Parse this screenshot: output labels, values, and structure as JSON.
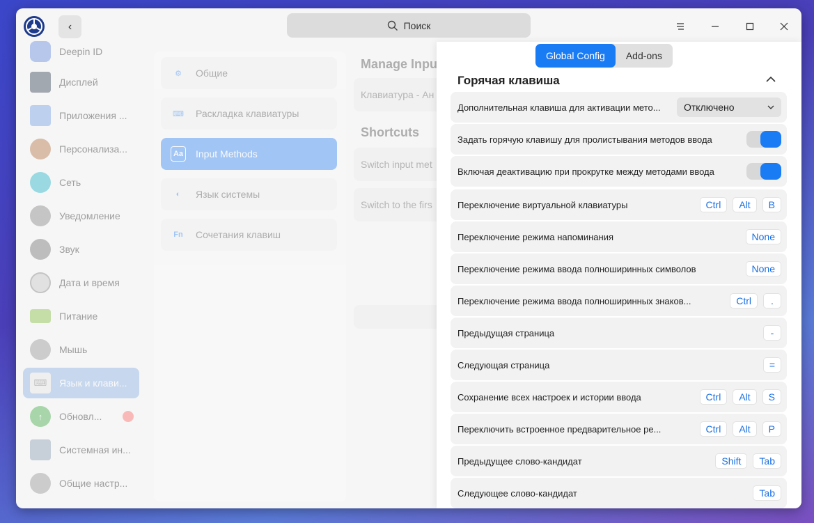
{
  "search": {
    "label": "Поиск"
  },
  "sidebar": {
    "items": [
      {
        "label": "Deepin ID",
        "icon": "deepin-id-icon",
        "color": "#6a8ee0"
      },
      {
        "label": "Дисплей",
        "icon": "display-icon",
        "color": "#3c4a5a"
      },
      {
        "label": "Приложения ...",
        "icon": "apps-icon",
        "color": "#7aa6e8"
      },
      {
        "label": "Персонализа...",
        "icon": "palette-icon",
        "color": "#b87a4a"
      },
      {
        "label": "Сеть",
        "icon": "network-icon",
        "color": "#2bb6c8"
      },
      {
        "label": "Уведомление",
        "icon": "bell-icon",
        "color": "#8a8a8a"
      },
      {
        "label": "Звук",
        "icon": "speaker-icon",
        "color": "#7a7a7a"
      },
      {
        "label": "Дата и время",
        "icon": "clock-icon",
        "color": "#c8c8c8"
      },
      {
        "label": "Питание",
        "icon": "battery-icon",
        "color": "#8bc34a"
      },
      {
        "label": "Мышь",
        "icon": "mouse-icon",
        "color": "#9a9a9a"
      },
      {
        "label": "Язык и клави...",
        "icon": "keyboard-icon",
        "color": "#e8e8e8"
      },
      {
        "label": "Обновл...",
        "icon": "update-icon",
        "color": "#4caf50"
      },
      {
        "label": "Системная ин...",
        "icon": "system-info-icon",
        "color": "#90a4b8"
      },
      {
        "label": "Общие настр...",
        "icon": "general-settings-icon",
        "color": "#9a9a9a"
      }
    ]
  },
  "middle": {
    "items": [
      {
        "label": "Общие",
        "icon": "gear-icon",
        "glyph": "⚙"
      },
      {
        "label": "Раскладка клавиатуры",
        "icon": "keyboard-layout-icon",
        "glyph": "⌨"
      },
      {
        "label": "Input Methods",
        "icon": "input-methods-icon",
        "glyph": "Aa"
      },
      {
        "label": "Язык системы",
        "icon": "globe-icon",
        "glyph": "◐"
      },
      {
        "label": "Сочетания клавиш",
        "icon": "fn-icon",
        "glyph": "Fn"
      }
    ]
  },
  "right_bg": {
    "manage_title": "Manage Inpu",
    "keyboard_row": "Клавиатура - Ан",
    "shortcuts_title": "Shortcuts",
    "switch_input": "Switch input met",
    "switch_first": "Switch to the firs"
  },
  "panel": {
    "tabs": [
      "Global Config",
      "Add-ons"
    ],
    "section_title": "Горячая клавиша",
    "dropdown": {
      "label": "Дополнительная клавиша для активации мето...",
      "value": "Отключено"
    },
    "toggles": [
      {
        "label": "Задать горячую клавишу для пролистывания методов ввода",
        "on": true
      },
      {
        "label": "Включая деактивацию при прокрутке между методами ввода",
        "on": true
      }
    ],
    "shortcuts": [
      {
        "label": "Переключение виртуальной клавиатуры",
        "keys": [
          "Ctrl",
          "Alt",
          "B"
        ]
      },
      {
        "label": "Переключение режима напоминания",
        "keys": [
          "None"
        ]
      },
      {
        "label": "Переключение режима ввода полноширинных символов",
        "keys": [
          "None"
        ]
      },
      {
        "label": "Переключение режима ввода полноширинных знаков...",
        "keys": [
          "Ctrl",
          "."
        ]
      },
      {
        "label": "Предыдущая страница",
        "keys": [
          "-"
        ]
      },
      {
        "label": "Следующая страница",
        "keys": [
          "="
        ]
      },
      {
        "label": "Сохранение всех настроек и истории ввода",
        "keys": [
          "Ctrl",
          "Alt",
          "S"
        ]
      },
      {
        "label": "Переключить встроенное предварительное ре...",
        "keys": [
          "Ctrl",
          "Alt",
          "P"
        ]
      },
      {
        "label": "Предыдущее слово-кандидат",
        "keys": [
          "Shift",
          "Tab"
        ]
      },
      {
        "label": "Следующее слово-кандидат",
        "keys": [
          "Tab"
        ]
      }
    ]
  },
  "colors": {
    "accent": "#1a7cf5",
    "sidebar_active": "#8fb3e6"
  }
}
